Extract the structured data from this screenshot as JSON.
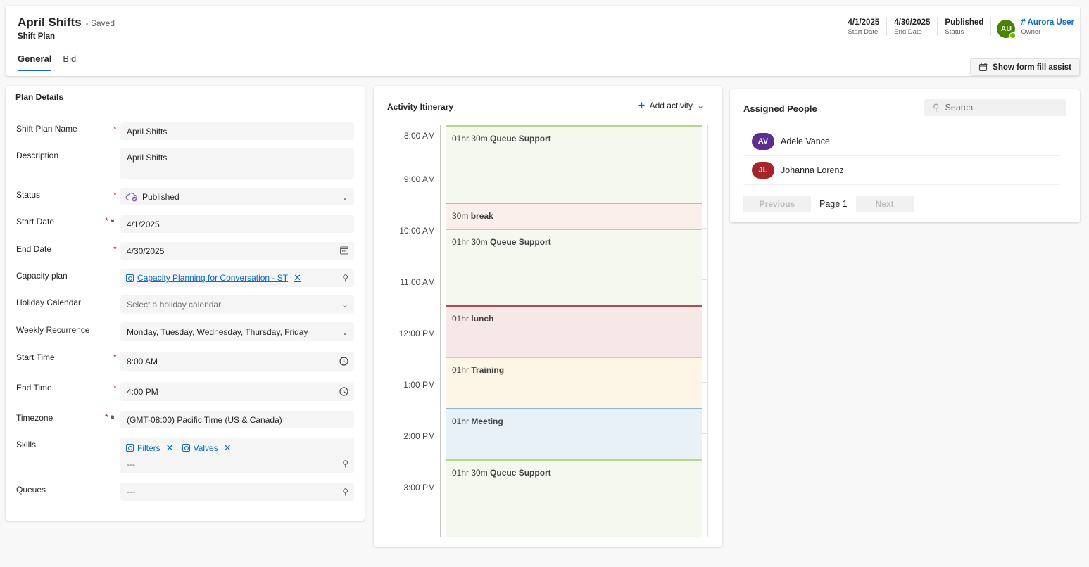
{
  "header": {
    "title": "April Shifts",
    "saved": "- Saved",
    "entity": "Shift Plan",
    "tabs": [
      "General",
      "Bid"
    ],
    "fields": [
      {
        "value": "4/1/2025",
        "label": "Start Date"
      },
      {
        "value": "4/30/2025",
        "label": "End Date"
      },
      {
        "value": "Published",
        "label": "Status"
      }
    ],
    "owner": {
      "initials": "AU",
      "name": "# Aurora User",
      "label": "Owner"
    },
    "form_assist": "Show form fill assist"
  },
  "plan": {
    "section_title": "Plan Details",
    "name": {
      "label": "Shift Plan Name",
      "value": "April Shifts"
    },
    "description": {
      "label": "Description",
      "value": "April Shifts"
    },
    "status": {
      "label": "Status",
      "value": "Published"
    },
    "start_date": {
      "label": "Start Date",
      "value": "4/1/2025"
    },
    "end_date": {
      "label": "End Date",
      "value": "4/30/2025"
    },
    "capacity": {
      "label": "Capacity plan",
      "value": "Capacity Planning for Conversation - ST"
    },
    "holiday": {
      "label": "Holiday Calendar",
      "placeholder": "Select a holiday calendar"
    },
    "recurrence": {
      "label": "Weekly Recurrence",
      "value": "Monday, Tuesday, Wednesday, Thursday, Friday"
    },
    "start_time": {
      "label": "Start Time",
      "value": "8:00 AM"
    },
    "end_time": {
      "label": "End Time",
      "value": "4:00 PM"
    },
    "timezone": {
      "label": "Timezone",
      "value": "(GMT-08:00) Pacific Time (US & Canada)"
    },
    "skills": {
      "label": "Skills",
      "tags": [
        "Filters",
        "Valves"
      ],
      "placeholder": "---"
    },
    "queues": {
      "label": "Queues",
      "placeholder": "---"
    }
  },
  "itinerary": {
    "title": "Activity Itinerary",
    "add_label": "Add activity",
    "ticks": [
      "8:00 AM",
      "9:00 AM",
      "10:00 AM",
      "11:00 AM",
      "12:00 PM",
      "1:00 PM",
      "2:00 PM",
      "3:00 PM"
    ],
    "activities": [
      {
        "duration": "01hr 30m",
        "name": "Queue Support",
        "kind": "queue"
      },
      {
        "duration": "30m",
        "name": "break",
        "kind": "break"
      },
      {
        "duration": "01hr 30m",
        "name": "Queue Support",
        "kind": "queue"
      },
      {
        "duration": "01hr",
        "name": "lunch",
        "kind": "lunch"
      },
      {
        "duration": "01hr",
        "name": "Training",
        "kind": "training"
      },
      {
        "duration": "01hr",
        "name": "Meeting",
        "kind": "meeting"
      },
      {
        "duration": "01hr 30m",
        "name": "Queue Support",
        "kind": "queue"
      }
    ]
  },
  "people": {
    "title": "Assigned People",
    "search_placeholder": "Search",
    "list": [
      {
        "initials": "AV",
        "name": "Adele Vance",
        "color": "#5c2e91"
      },
      {
        "initials": "JL",
        "name": "Johanna Lorenz",
        "color": "#a4262c"
      }
    ],
    "previous": "Previous",
    "page": "Page 1",
    "next": "Next"
  }
}
